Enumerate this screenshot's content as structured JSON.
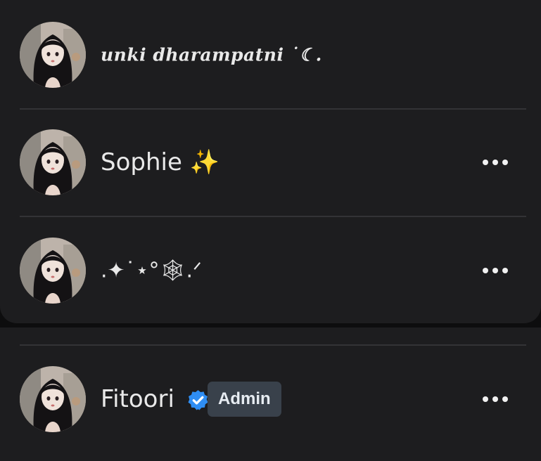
{
  "members_list": [
    {
      "name": "unki dharampatni ˙☾.",
      "style": "fancy-script",
      "avatar": "avatar-girl-illustration",
      "has_more_menu": false
    },
    {
      "name": "Sophie",
      "emoji": "✨",
      "avatar": "avatar-girl-illustration",
      "has_more_menu": true
    },
    {
      "name": ".✦˙⋆°🕸.ᐟ",
      "avatar": "avatar-girl-illustration",
      "has_more_menu": true
    }
  ],
  "admin_member": {
    "name": "Fitoori",
    "verified_icon": "verified-check-icon",
    "badge": "Admin",
    "avatar": "avatar-girl-illustration",
    "has_more_menu": true
  },
  "icons": {
    "more": "more-options-icon",
    "verified": "verified-check-icon"
  },
  "colors": {
    "background": "#0d0d0e",
    "card": "#1d1d1f",
    "divider": "#333336",
    "verified_blue": "#2f8ef4",
    "badge_bg": "#39414b",
    "text": "#e9e9e9"
  }
}
